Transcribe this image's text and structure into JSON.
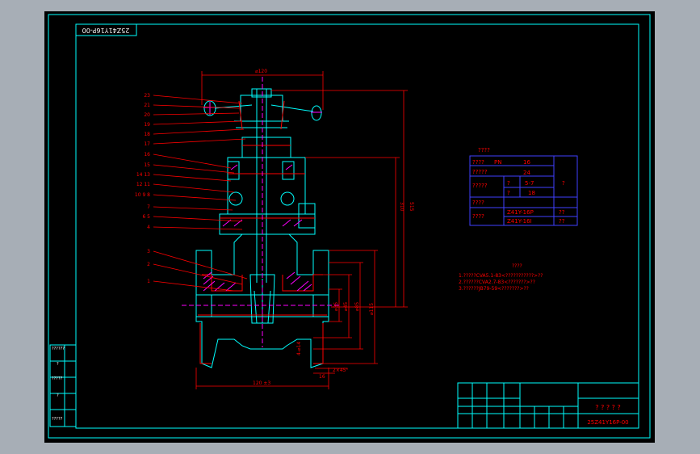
{
  "drawing": {
    "code_box": "25Z41Y16P-00",
    "dimensions": {
      "top_width": "⌀120",
      "height_outer": "515",
      "height_inner": "310",
      "length": "120 ±3",
      "d1": "⌀35",
      "d2": "⌀45",
      "d3": "⌀85",
      "d4": "⌀115",
      "bolt": "4-⌀14",
      "bottom_a": "2×45°",
      "bottom_b": "16"
    },
    "part_labels": [
      "23",
      "21",
      "20",
      "19",
      "18",
      "17",
      "16",
      "15",
      "14 13",
      "12 11",
      "10 9 8",
      "7",
      "6 5",
      "4",
      "3",
      "2",
      "1"
    ],
    "spec_table": {
      "title": "????",
      "rows": [
        {
          "k": "????",
          "u": "PN",
          "v": "16",
          "extra": ""
        },
        {
          "k": "?????",
          "u": "",
          "v": "24",
          "extra": "?"
        },
        {
          "k": "?????",
          "u": "?",
          "v": "5-7",
          "extra": ""
        },
        {
          "k": "",
          "u": "?",
          "v": "18",
          "extra": ""
        },
        {
          "k": "????",
          "u": "",
          "v": "",
          "extra": ""
        },
        {
          "k": "????",
          "u": "",
          "v": "Z41Y-16P",
          "extra": "??"
        },
        {
          "k": "",
          "u": "",
          "v": "Z41Y-16I",
          "extra": "??"
        }
      ]
    },
    "notes": {
      "title": "????",
      "lines": [
        "1.?????CVA5.1-83<???????????>??",
        "2.??????CVA2.7-83<???????>??",
        "3.??????JB79-59<???????>??"
      ]
    },
    "title_block": {
      "name": "? ? ? ? ?",
      "code": "25Z41Y16P-00"
    },
    "revision_cells": [
      "??????",
      "?",
      "?????",
      "?",
      "?????"
    ]
  },
  "colors": {
    "frame": "#00ffff",
    "part": "#00ffff",
    "section": "#ff0000",
    "hatch": "#ff00ff",
    "dim": "#ff0000",
    "text_blue": "#4040ff",
    "white": "#ffffff"
  }
}
